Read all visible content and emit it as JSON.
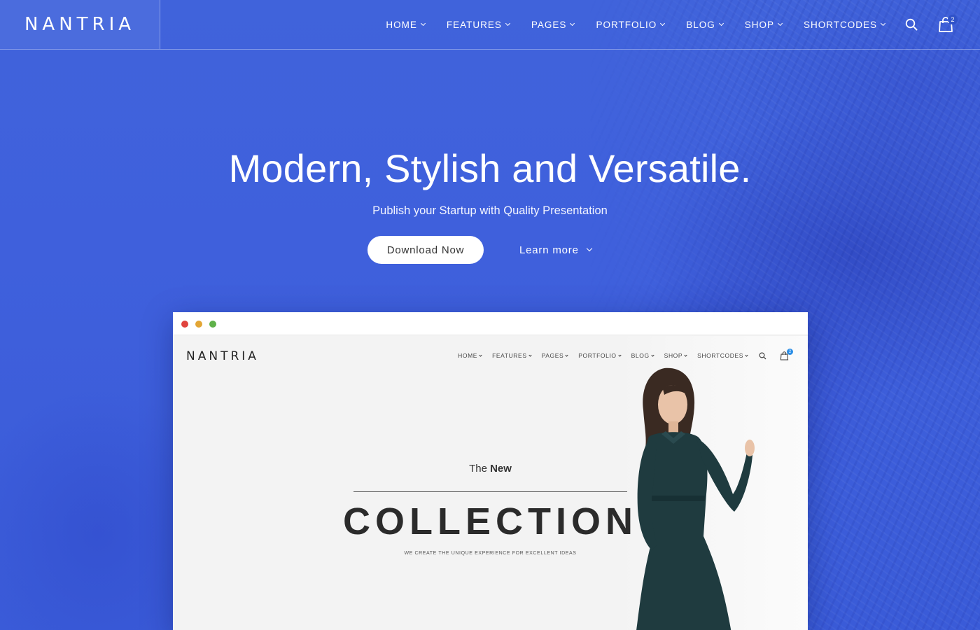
{
  "brand": {
    "logo": "NANTRIA"
  },
  "nav": {
    "items": [
      {
        "label": "HOME"
      },
      {
        "label": "FEATURES"
      },
      {
        "label": "PAGES"
      },
      {
        "label": "PORTFOLIO"
      },
      {
        "label": "BLOG"
      },
      {
        "label": "SHOP"
      },
      {
        "label": "SHORTCODES"
      }
    ],
    "cart_count": "2"
  },
  "hero": {
    "title": "Modern, Stylish and Versatile.",
    "subtitle": "Publish your Startup with Quality Presentation",
    "primary_button": "Download Now",
    "secondary_button": "Learn more"
  },
  "mockup": {
    "logo": "NANTRIA",
    "nav": {
      "items": [
        {
          "label": "HOME"
        },
        {
          "label": "FEATURES"
        },
        {
          "label": "PAGES"
        },
        {
          "label": "PORTFOLIO"
        },
        {
          "label": "BLOG"
        },
        {
          "label": "SHOP"
        },
        {
          "label": "SHORTCODES"
        }
      ],
      "cart_count": "2"
    },
    "the": "The",
    "new": "New",
    "headline": "COLLECTION",
    "tagline": "WE CREATE THE UNIQUE EXPERIENCE FOR EXCELLENT IDEAS"
  },
  "colors": {
    "background": "#3d5fdc",
    "button_bg": "#ffffff",
    "mock_badge": "#2b8ee6",
    "dot_red": "#e0443e",
    "dot_yellow": "#e3a635",
    "dot_green": "#5fb14a"
  }
}
